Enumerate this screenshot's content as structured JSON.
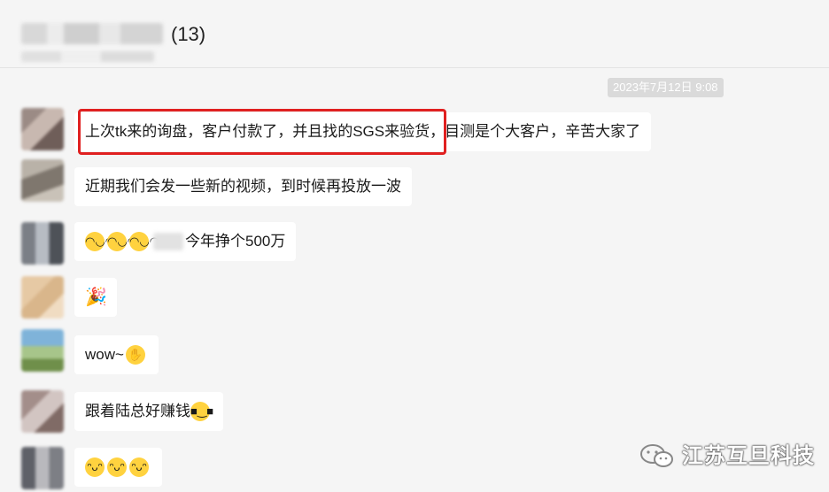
{
  "header": {
    "title_count": "(13)"
  },
  "timestamp": "2023年7月12日 9:08",
  "messages": [
    {
      "text": "上次tk来的询盘，客户付款了，并且找的SGS来验货，目测是个大客户，辛苦大家了"
    },
    {
      "text": "近期我们会发一些新的视频，到时候再投放一波"
    },
    {
      "emojis": [
        "blush-face",
        "blush-face",
        "blush-face"
      ],
      "text": "今年挣个500万"
    },
    {
      "emojis": [
        "party-popper"
      ]
    },
    {
      "text": "wow~",
      "emojis": [
        "hand-over-mouth-face"
      ]
    },
    {
      "text": "跟着陆总好赚钱",
      "emojis": [
        "sunglasses-face"
      ]
    },
    {
      "emojis": [
        "grinning-face",
        "grinning-face",
        "grinning-face"
      ]
    }
  ],
  "watermark": {
    "text": "江苏互旦科技",
    "icon": "wechat-icon"
  },
  "colors": {
    "highlight": "#e02020",
    "bubble": "#ffffff",
    "background": "#f5f5f5"
  }
}
